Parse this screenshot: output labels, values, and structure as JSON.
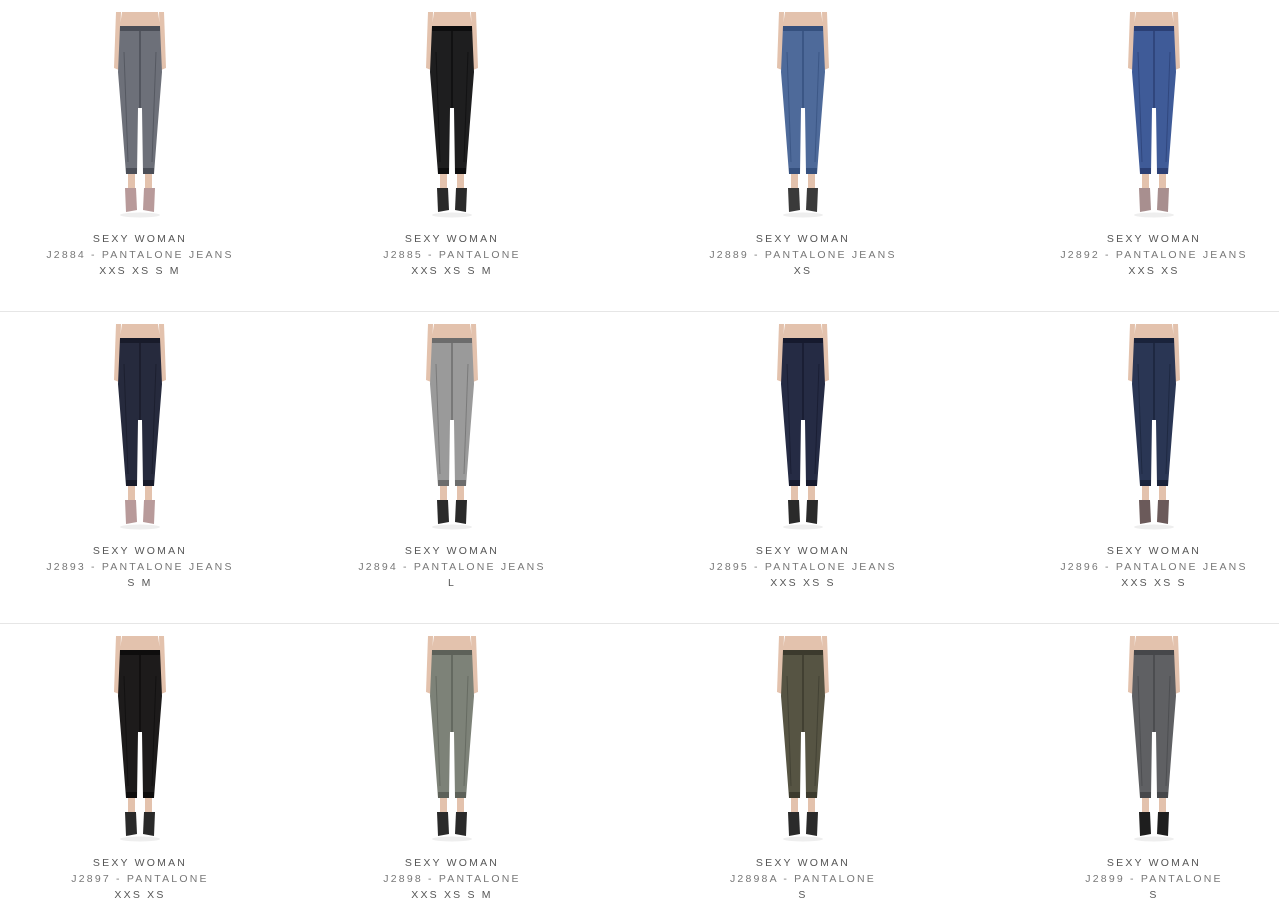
{
  "products": [
    {
      "brand": "SEXY WOMAN",
      "name": "J2884 - PANTALONE JEANS",
      "sizes": "XXS XS S M",
      "pant_color": "#6d7079",
      "shade_color": "#4b4e57",
      "shoe_color": "#b89a9a"
    },
    {
      "brand": "SEXY WOMAN",
      "name": "J2885 - PANTALONE",
      "sizes": "XXS XS S M",
      "pant_color": "#1e1e1f",
      "shade_color": "#0d0d0e",
      "shoe_color": "#2a2a2a"
    },
    {
      "brand": "SEXY WOMAN",
      "name": "J2889 - PANTALONE JEANS",
      "sizes": "XS",
      "pant_color": "#4e6a9a",
      "shade_color": "#35507e",
      "shoe_color": "#3a3a3a"
    },
    {
      "brand": "SEXY WOMAN",
      "name": "J2892 - PANTALONE JEANS",
      "sizes": "XXS XS",
      "pant_color": "#3f5b98",
      "shade_color": "#2b3f74",
      "shoe_color": "#a88f8f"
    },
    {
      "brand": "SEXY WOMAN",
      "name": "J2893 - PANTALONE JEANS",
      "sizes": "S M",
      "pant_color": "#262a3d",
      "shade_color": "#181b2a",
      "shoe_color": "#b89a9a"
    },
    {
      "brand": "SEXY WOMAN",
      "name": "J2894 - PANTALONE JEANS",
      "sizes": "L",
      "pant_color": "#9a9a9a",
      "shade_color": "#6c6c6c",
      "shoe_color": "#2a2a2a"
    },
    {
      "brand": "SEXY WOMAN",
      "name": "J2895 - PANTALONE JEANS",
      "sizes": "XXS XS S",
      "pant_color": "#252b44",
      "shade_color": "#161a2e",
      "shoe_color": "#2a2a2a"
    },
    {
      "brand": "SEXY WOMAN",
      "name": "J2896 - PANTALONE JEANS",
      "sizes": "XXS XS S",
      "pant_color": "#2a3654",
      "shade_color": "#1a233b",
      "shoe_color": "#6b5a5a"
    },
    {
      "brand": "SEXY WOMAN",
      "name": "J2897 - PANTALONE",
      "sizes": "XXS XS",
      "pant_color": "#1d1b1b",
      "shade_color": "#0e0d0d",
      "shoe_color": "#2a2a2a"
    },
    {
      "brand": "SEXY WOMAN",
      "name": "J2898 - PANTALONE",
      "sizes": "XXS XS S M",
      "pant_color": "#7d8278",
      "shade_color": "#5d6159",
      "shoe_color": "#2a2a2a"
    },
    {
      "brand": "SEXY WOMAN",
      "name": "J2898A - PANTALONE",
      "sizes": "S",
      "pant_color": "#565443",
      "shade_color": "#3c3a2d",
      "shoe_color": "#2a2a2a"
    },
    {
      "brand": "SEXY WOMAN",
      "name": "J2899 - PANTALONE",
      "sizes": "S",
      "pant_color": "#5f6063",
      "shade_color": "#46474a",
      "shoe_color": "#1e1e1e"
    }
  ],
  "skin_color": "#e3c2ad",
  "divider_color": "#e6e6e6"
}
